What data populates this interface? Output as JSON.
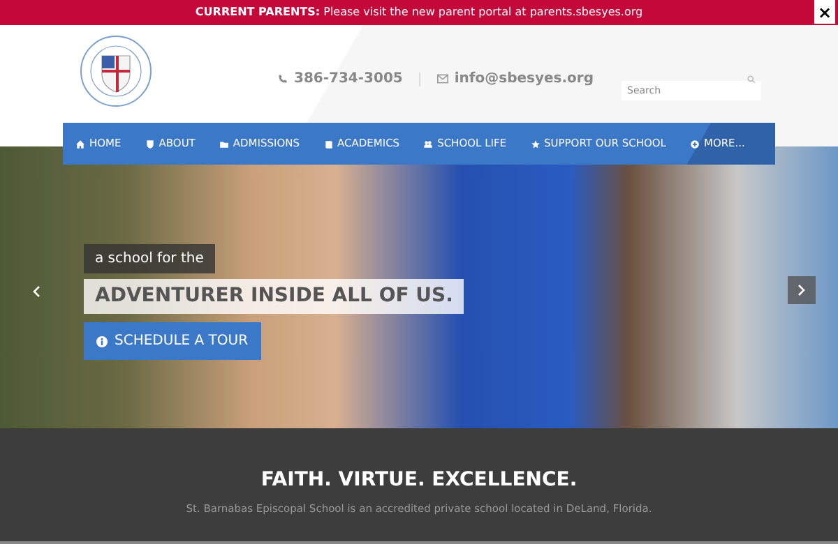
{
  "announcement": {
    "label": "CURRENT PARENTS:",
    "text": "Please visit the new parent portal at parents.sbesyes.org",
    "close": "×"
  },
  "header": {
    "phone": "386-734-3005",
    "email": "info@sbesyes.org",
    "search": {
      "placeholder": "Search"
    }
  },
  "nav": [
    {
      "label": "HOME"
    },
    {
      "label": "ABOUT"
    },
    {
      "label": "ADMISSIONS"
    },
    {
      "label": "ACADEMICS"
    },
    {
      "label": "SCHOOL LIFE"
    },
    {
      "label": "SUPPORT OUR SCHOOL"
    },
    {
      "label": "MORE..."
    }
  ],
  "hero": {
    "kicker": "a school for the",
    "headline": "ADVENTURER INSIDE ALL OF US.",
    "button": "SCHEDULE A TOUR"
  },
  "tagline": {
    "title": "FAITH. VIRTUE. EXCELLENCE.",
    "text": "St. Barnabas Episcopal School is an accredited private school located in DeLand, Florida."
  }
}
